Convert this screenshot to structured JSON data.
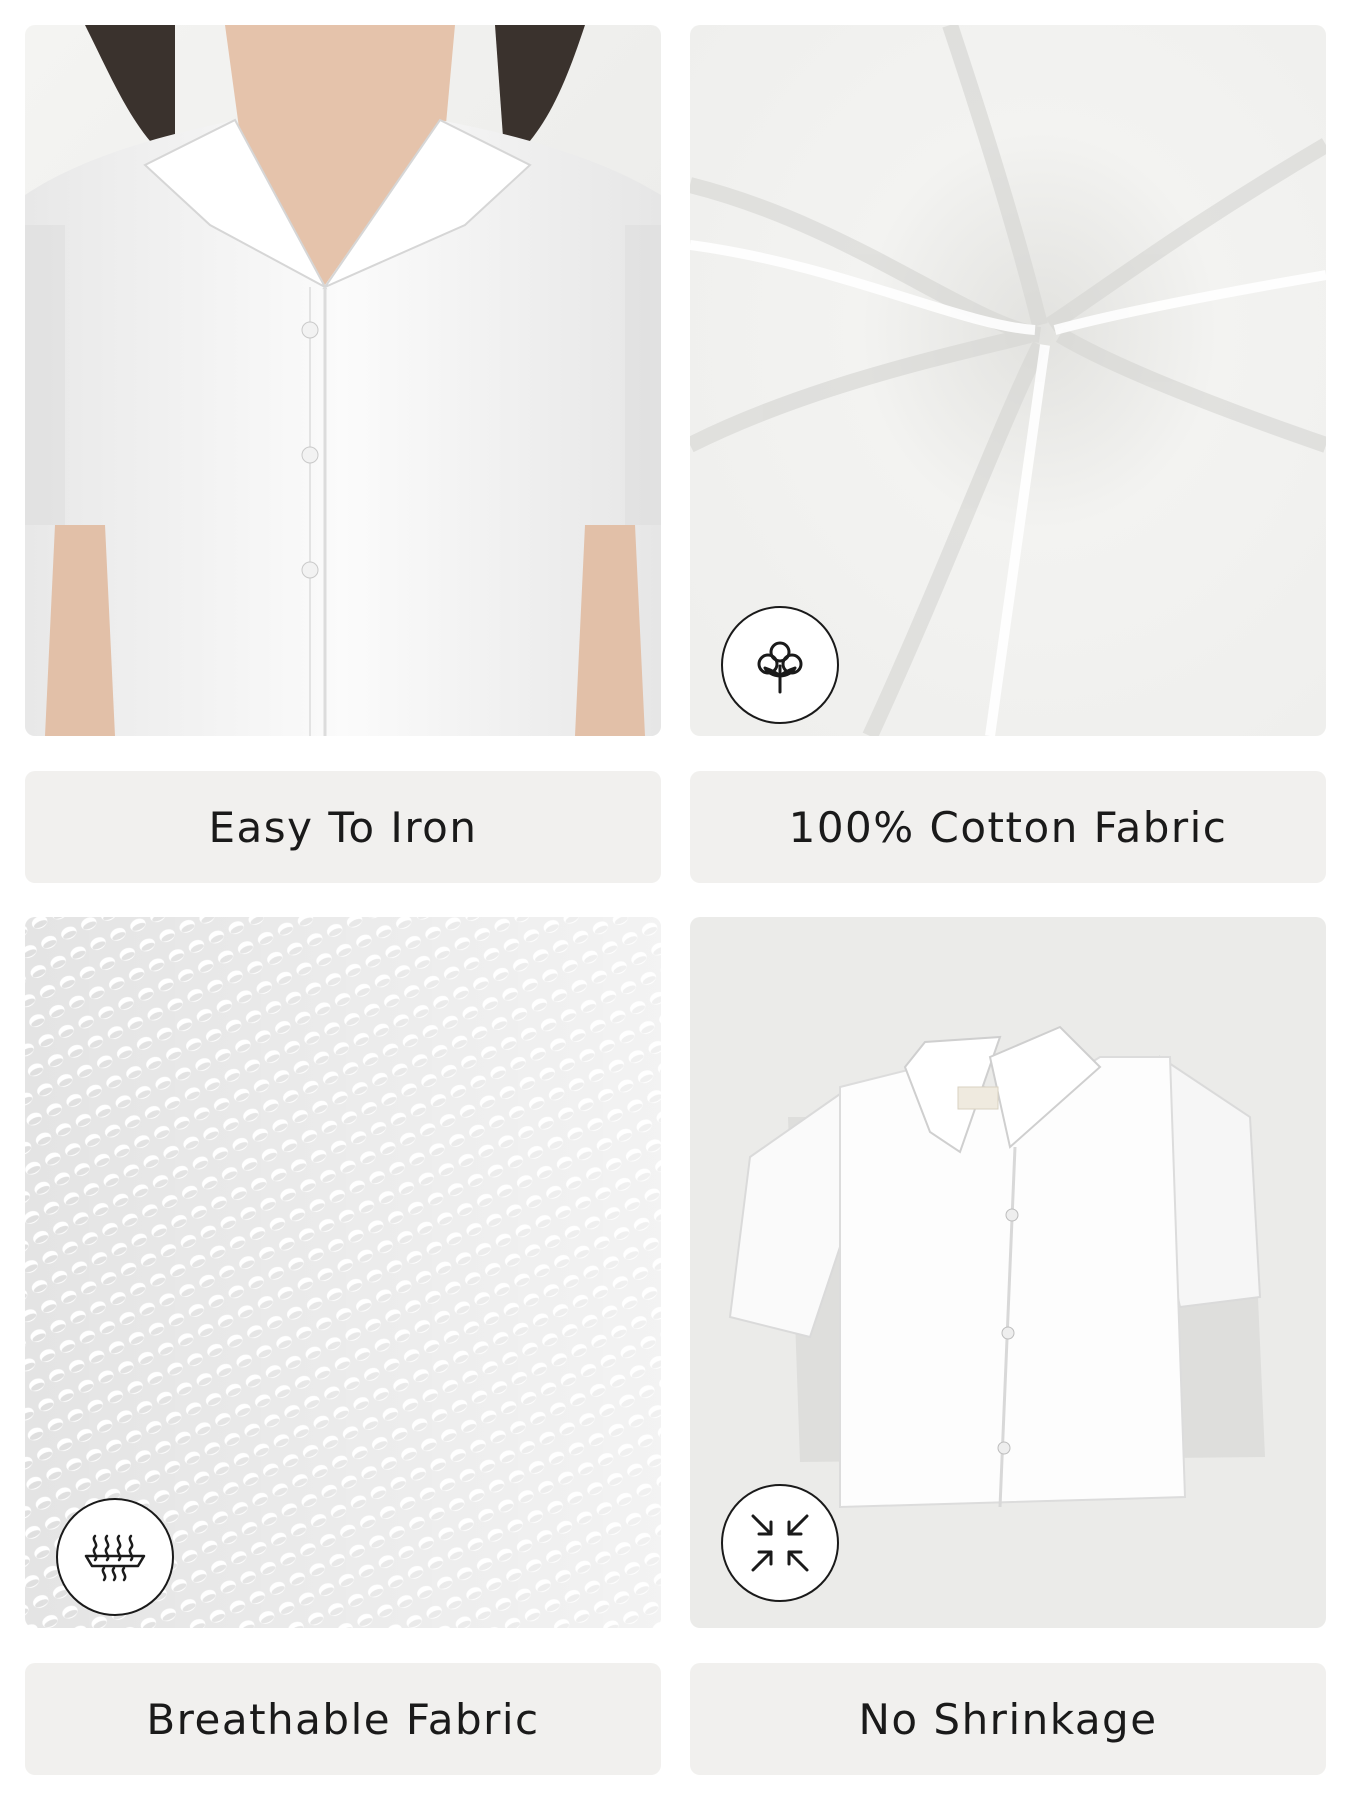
{
  "features": [
    {
      "label": "Easy To Iron",
      "image": "model wearing white short-sleeve shirt",
      "icon": null
    },
    {
      "label": "100% Cotton Fabric",
      "image": "white cotton fabric swirl",
      "icon": "cotton-flower-icon"
    },
    {
      "label": "Breathable Fabric",
      "image": "close-up of fabric weave",
      "icon": "breathable-fabric-icon"
    },
    {
      "label": "No Shrinkage",
      "image": "white cropped shirt flat lay",
      "icon": "no-shrink-arrows-icon"
    }
  ],
  "colors": {
    "label_bg": "#f1f0ee",
    "text": "#1a1a1a",
    "icon_stroke": "#1a1a1a"
  }
}
